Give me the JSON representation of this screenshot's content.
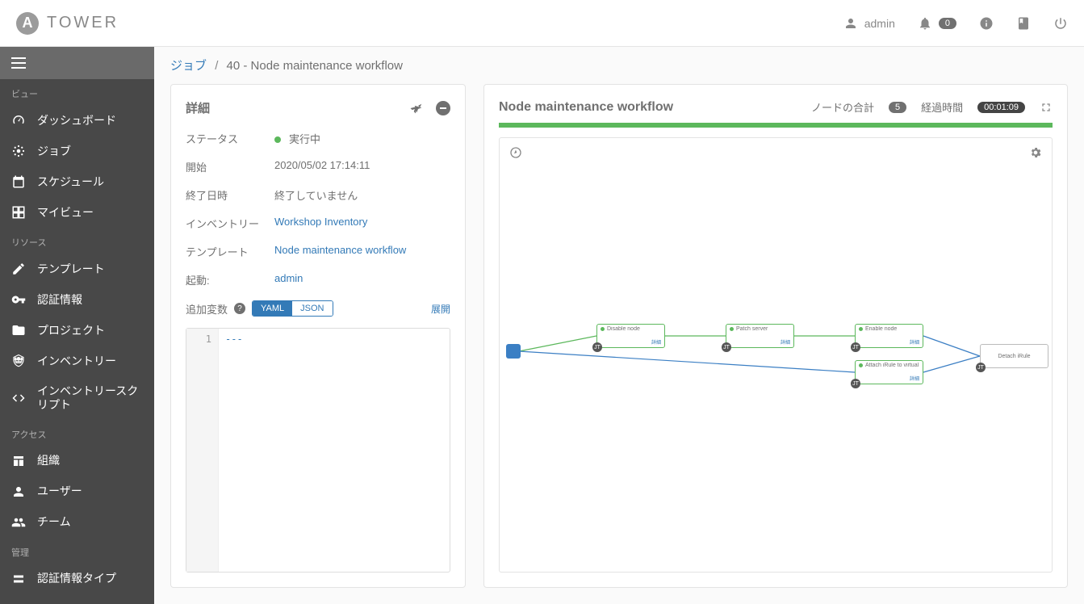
{
  "brand": {
    "logo_letter": "A",
    "name": "TOWER"
  },
  "header": {
    "user": "admin",
    "notification_count": "0"
  },
  "sidebar": {
    "sections": {
      "view": {
        "label": "ビュー",
        "items": [
          {
            "label": "ダッシュボード",
            "icon": "dashboard"
          },
          {
            "label": "ジョブ",
            "icon": "jobs"
          },
          {
            "label": "スケジュール",
            "icon": "schedule"
          },
          {
            "label": "マイビュー",
            "icon": "myview"
          }
        ]
      },
      "resource": {
        "label": "リソース",
        "items": [
          {
            "label": "テンプレート",
            "icon": "template"
          },
          {
            "label": "認証情報",
            "icon": "key"
          },
          {
            "label": "プロジェクト",
            "icon": "folder"
          },
          {
            "label": "インベントリー",
            "icon": "inventory"
          },
          {
            "label": "インベントリースクリプト",
            "icon": "code"
          }
        ]
      },
      "access": {
        "label": "アクセス",
        "items": [
          {
            "label": "組織",
            "icon": "org"
          },
          {
            "label": "ユーザー",
            "icon": "user"
          },
          {
            "label": "チーム",
            "icon": "team"
          }
        ]
      },
      "admin": {
        "label": "管理",
        "items": [
          {
            "label": "認証情報タイプ",
            "icon": "credtype"
          }
        ]
      }
    }
  },
  "breadcrumb": {
    "root": "ジョブ",
    "current": "40 - Node maintenance workflow"
  },
  "details": {
    "title": "詳細",
    "rows": {
      "status": {
        "label": "ステータス",
        "value": "実行中"
      },
      "start": {
        "label": "開始",
        "value": "2020/05/02 17:14:11"
      },
      "end": {
        "label": "終了日時",
        "value": "終了していません"
      },
      "inventory": {
        "label": "インベントリー",
        "value": "Workshop Inventory"
      },
      "template": {
        "label": "テンプレート",
        "value": "Node maintenance workflow"
      },
      "launched_by": {
        "label": "起動:",
        "value": "admin"
      },
      "extra_vars": {
        "label": "追加変数"
      }
    },
    "format": {
      "yaml": "YAML",
      "json": "JSON"
    },
    "expand": "展開",
    "code_line_num": "1",
    "code_content": "---"
  },
  "workflow": {
    "title": "Node maintenance workflow",
    "total_label": "ノードの合計",
    "total_count": "5",
    "elapsed_label": "経過時間",
    "elapsed_value": "00:01:09",
    "nodes": {
      "n1": {
        "title": "Disable node",
        "detail": "詳細"
      },
      "n2": {
        "title": "Patch server",
        "detail": "詳細"
      },
      "n3": {
        "title": "Enable node",
        "detail": "詳細"
      },
      "n4": {
        "title": "Attach iRule to virtual ser...",
        "detail": "詳細"
      },
      "n5": {
        "title": "Detach iRule",
        "detail": ""
      }
    },
    "badge_text": "JT"
  }
}
